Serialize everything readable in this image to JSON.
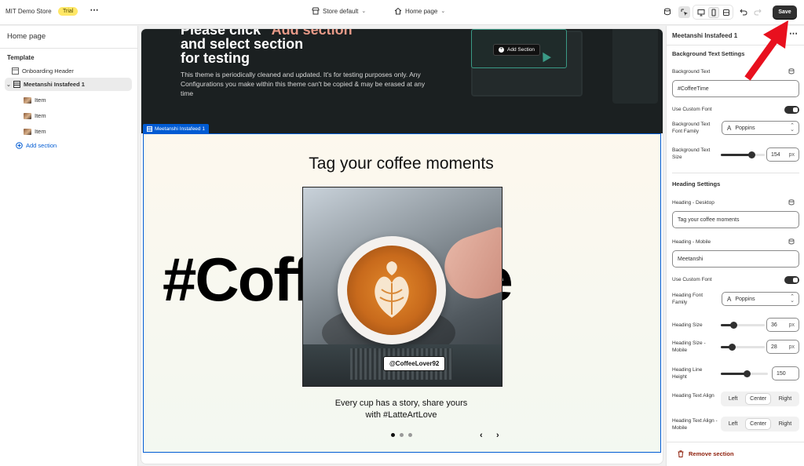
{
  "topbar": {
    "store_name": "MIT Demo Store",
    "badge": "Trial",
    "store_select": "Store default",
    "page_select": "Home page",
    "save_label": "Save"
  },
  "left": {
    "title": "Home page",
    "template_label": "Template",
    "tree": [
      {
        "label": "Onboarding Header"
      },
      {
        "label": "Meetanshi Instafeed 1"
      },
      {
        "label": "Item"
      },
      {
        "label": "Item"
      },
      {
        "label": "Item"
      }
    ],
    "add_section": "Add section"
  },
  "preview": {
    "onboard_heading_line1_prefix": "Please click",
    "onboard_heading_line1_highlight": "\"Add section\"",
    "onboard_heading_line2": "and select section",
    "onboard_heading_line3": "for testing",
    "onboard_text": "This theme is periodically cleaned and updated. It's for testing purposes only. Any Configurations you make within this theme can't be copied & may be erased at any time",
    "onboard_add_section": "Add Section",
    "selected_tag": "Meetanshi Instafeed 1",
    "heading": "Tag your coffee moments",
    "background_text": "#CoffeeTime",
    "handle": "@CoffeeLover92",
    "caption_line1": "Every cup has a story, share yours",
    "caption_line2": "with #LatteArtLove",
    "prev": "‹",
    "next": "›"
  },
  "right": {
    "title": "Meetanshi Instafeed 1",
    "bg_settings": "Background Text Settings",
    "bg_text_label": "Background Text",
    "bg_text_value": "#CoffeeTime",
    "use_custom_font": "Use Custom Font",
    "bg_font_family_label": "Background Text Font Family",
    "bg_font_family_value": "Poppins",
    "bg_text_size_label": "Background Text Size",
    "bg_text_size_value": "154",
    "unit_px": "px",
    "heading_settings": "Heading Settings",
    "heading_desktop_label": "Heading - Desktop",
    "heading_desktop_value": "Tag your coffee moments",
    "heading_mobile_label": "Heading - Mobile",
    "heading_mobile_value": "Meetanshi",
    "use_custom_font_2": "Use Custom Font",
    "heading_font_family_label": "Heading Font Family",
    "heading_font_family_value": "Poppins",
    "heading_size_label": "Heading Size",
    "heading_size_value": "36",
    "heading_size_mobile_label": "Heading Size - Mobile",
    "heading_size_mobile_value": "28",
    "heading_line_height_label": "Heading Line Height",
    "heading_line_height_value": "150",
    "heading_text_align_label": "Heading Text Align",
    "heading_text_align_mobile_label": "Heading Text Align - Mobile",
    "align_options": [
      "Left",
      "Center",
      "Right"
    ],
    "remove_section": "Remove section"
  },
  "sliders": {
    "bg_text_size_fraction": 0.7,
    "heading_size_fraction": 0.3,
    "heading_size_mobile_fraction": 0.25,
    "heading_line_height_fraction": 0.55
  },
  "colors": {
    "accent": "#005bd3",
    "save_bg": "#303030",
    "annotation_arrow": "#e8101e",
    "trial_badge": "#ffe766",
    "remove_text": "#8e1f0b"
  }
}
